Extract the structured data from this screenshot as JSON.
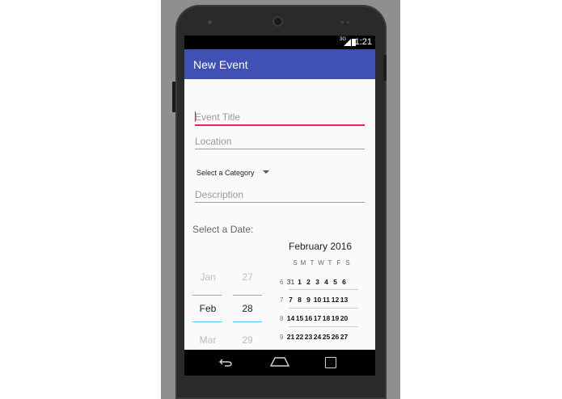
{
  "status_bar": {
    "network": "3G",
    "time": "1:21"
  },
  "app_bar": {
    "title": "New Event"
  },
  "form": {
    "event_title_placeholder": "Event Title",
    "location_placeholder": "Location",
    "category": {
      "selected": "Select a Category"
    },
    "description_placeholder": "Description",
    "date_label": "Select a Date:"
  },
  "date_picker": {
    "month": {
      "prev": "Jan",
      "selected": "Feb",
      "next": "Mar"
    },
    "day": {
      "prev": "27",
      "selected": "28",
      "next": "29"
    }
  },
  "calendar": {
    "title": "February 2016",
    "weekday_headers": [
      "S",
      "M",
      "T",
      "W",
      "T",
      "F",
      "S"
    ],
    "weeks": [
      {
        "week": "6",
        "days": [
          "31",
          "1",
          "2",
          "3",
          "4",
          "5",
          "6"
        ]
      },
      {
        "week": "7",
        "days": [
          "7",
          "8",
          "9",
          "10",
          "11",
          "12",
          "13"
        ]
      },
      {
        "week": "8",
        "days": [
          "14",
          "15",
          "16",
          "17",
          "18",
          "19",
          "20"
        ]
      },
      {
        "week": "9",
        "days": [
          "21",
          "22",
          "23",
          "24",
          "25",
          "26",
          "27"
        ]
      }
    ]
  },
  "colors": {
    "primary": "#3f51b5",
    "accent": "#e91e63",
    "picker_divider": "#4fc3f7"
  },
  "nav_icons": [
    "back-icon",
    "home-icon",
    "recent-apps-icon"
  ]
}
